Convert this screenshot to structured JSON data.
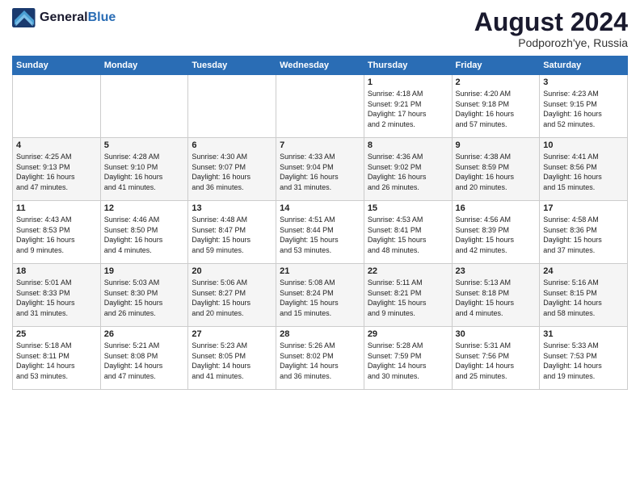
{
  "header": {
    "logo_general": "General",
    "logo_blue": "Blue",
    "month_year": "August 2024",
    "location": "Podporozh'ye, Russia"
  },
  "days_of_week": [
    "Sunday",
    "Monday",
    "Tuesday",
    "Wednesday",
    "Thursday",
    "Friday",
    "Saturday"
  ],
  "weeks": [
    [
      {
        "day": "",
        "info": ""
      },
      {
        "day": "",
        "info": ""
      },
      {
        "day": "",
        "info": ""
      },
      {
        "day": "",
        "info": ""
      },
      {
        "day": "1",
        "info": "Sunrise: 4:18 AM\nSunset: 9:21 PM\nDaylight: 17 hours\nand 2 minutes."
      },
      {
        "day": "2",
        "info": "Sunrise: 4:20 AM\nSunset: 9:18 PM\nDaylight: 16 hours\nand 57 minutes."
      },
      {
        "day": "3",
        "info": "Sunrise: 4:23 AM\nSunset: 9:15 PM\nDaylight: 16 hours\nand 52 minutes."
      }
    ],
    [
      {
        "day": "4",
        "info": "Sunrise: 4:25 AM\nSunset: 9:13 PM\nDaylight: 16 hours\nand 47 minutes."
      },
      {
        "day": "5",
        "info": "Sunrise: 4:28 AM\nSunset: 9:10 PM\nDaylight: 16 hours\nand 41 minutes."
      },
      {
        "day": "6",
        "info": "Sunrise: 4:30 AM\nSunset: 9:07 PM\nDaylight: 16 hours\nand 36 minutes."
      },
      {
        "day": "7",
        "info": "Sunrise: 4:33 AM\nSunset: 9:04 PM\nDaylight: 16 hours\nand 31 minutes."
      },
      {
        "day": "8",
        "info": "Sunrise: 4:36 AM\nSunset: 9:02 PM\nDaylight: 16 hours\nand 26 minutes."
      },
      {
        "day": "9",
        "info": "Sunrise: 4:38 AM\nSunset: 8:59 PM\nDaylight: 16 hours\nand 20 minutes."
      },
      {
        "day": "10",
        "info": "Sunrise: 4:41 AM\nSunset: 8:56 PM\nDaylight: 16 hours\nand 15 minutes."
      }
    ],
    [
      {
        "day": "11",
        "info": "Sunrise: 4:43 AM\nSunset: 8:53 PM\nDaylight: 16 hours\nand 9 minutes."
      },
      {
        "day": "12",
        "info": "Sunrise: 4:46 AM\nSunset: 8:50 PM\nDaylight: 16 hours\nand 4 minutes."
      },
      {
        "day": "13",
        "info": "Sunrise: 4:48 AM\nSunset: 8:47 PM\nDaylight: 15 hours\nand 59 minutes."
      },
      {
        "day": "14",
        "info": "Sunrise: 4:51 AM\nSunset: 8:44 PM\nDaylight: 15 hours\nand 53 minutes."
      },
      {
        "day": "15",
        "info": "Sunrise: 4:53 AM\nSunset: 8:41 PM\nDaylight: 15 hours\nand 48 minutes."
      },
      {
        "day": "16",
        "info": "Sunrise: 4:56 AM\nSunset: 8:39 PM\nDaylight: 15 hours\nand 42 minutes."
      },
      {
        "day": "17",
        "info": "Sunrise: 4:58 AM\nSunset: 8:36 PM\nDaylight: 15 hours\nand 37 minutes."
      }
    ],
    [
      {
        "day": "18",
        "info": "Sunrise: 5:01 AM\nSunset: 8:33 PM\nDaylight: 15 hours\nand 31 minutes."
      },
      {
        "day": "19",
        "info": "Sunrise: 5:03 AM\nSunset: 8:30 PM\nDaylight: 15 hours\nand 26 minutes."
      },
      {
        "day": "20",
        "info": "Sunrise: 5:06 AM\nSunset: 8:27 PM\nDaylight: 15 hours\nand 20 minutes."
      },
      {
        "day": "21",
        "info": "Sunrise: 5:08 AM\nSunset: 8:24 PM\nDaylight: 15 hours\nand 15 minutes."
      },
      {
        "day": "22",
        "info": "Sunrise: 5:11 AM\nSunset: 8:21 PM\nDaylight: 15 hours\nand 9 minutes."
      },
      {
        "day": "23",
        "info": "Sunrise: 5:13 AM\nSunset: 8:18 PM\nDaylight: 15 hours\nand 4 minutes."
      },
      {
        "day": "24",
        "info": "Sunrise: 5:16 AM\nSunset: 8:15 PM\nDaylight: 14 hours\nand 58 minutes."
      }
    ],
    [
      {
        "day": "25",
        "info": "Sunrise: 5:18 AM\nSunset: 8:11 PM\nDaylight: 14 hours\nand 53 minutes."
      },
      {
        "day": "26",
        "info": "Sunrise: 5:21 AM\nSunset: 8:08 PM\nDaylight: 14 hours\nand 47 minutes."
      },
      {
        "day": "27",
        "info": "Sunrise: 5:23 AM\nSunset: 8:05 PM\nDaylight: 14 hours\nand 41 minutes."
      },
      {
        "day": "28",
        "info": "Sunrise: 5:26 AM\nSunset: 8:02 PM\nDaylight: 14 hours\nand 36 minutes."
      },
      {
        "day": "29",
        "info": "Sunrise: 5:28 AM\nSunset: 7:59 PM\nDaylight: 14 hours\nand 30 minutes."
      },
      {
        "day": "30",
        "info": "Sunrise: 5:31 AM\nSunset: 7:56 PM\nDaylight: 14 hours\nand 25 minutes."
      },
      {
        "day": "31",
        "info": "Sunrise: 5:33 AM\nSunset: 7:53 PM\nDaylight: 14 hours\nand 19 minutes."
      }
    ]
  ]
}
